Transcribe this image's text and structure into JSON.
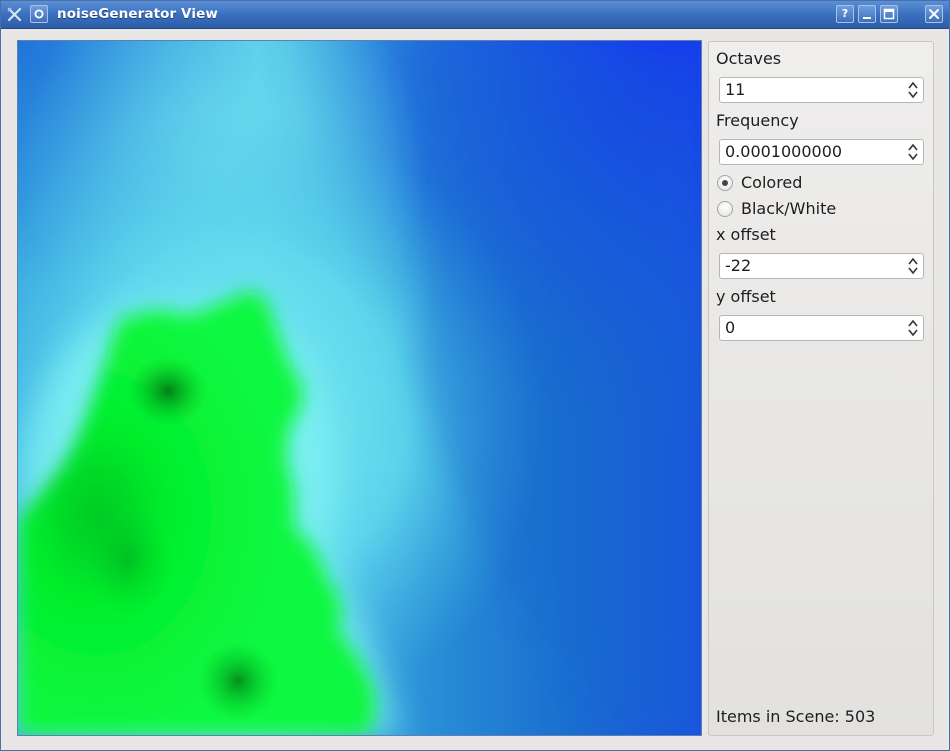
{
  "window": {
    "title": "noiseGenerator View",
    "buttons": {
      "help": "?",
      "minimize": "_",
      "maximize": "□",
      "close": "✕"
    },
    "app_icon": "tool-icon",
    "menu_icon": "gear-icon"
  },
  "controls": {
    "octaves": {
      "label": "Octaves",
      "value": "11"
    },
    "frequency": {
      "label": "Frequency",
      "value": "0.0001000000"
    },
    "mode": {
      "options": [
        {
          "label": "Colored",
          "checked": true
        },
        {
          "label": "Black/White",
          "checked": false
        }
      ]
    },
    "x_offset": {
      "label": "x offset",
      "value": "-22"
    },
    "y_offset": {
      "label": "y offset",
      "value": "0"
    }
  },
  "status": {
    "text": "Items in Scene: 503"
  },
  "colors": {
    "titlebar": "#3a6fbf",
    "land": "#00f22c",
    "shallow": "#6cefef",
    "deep": "#1633f5"
  }
}
